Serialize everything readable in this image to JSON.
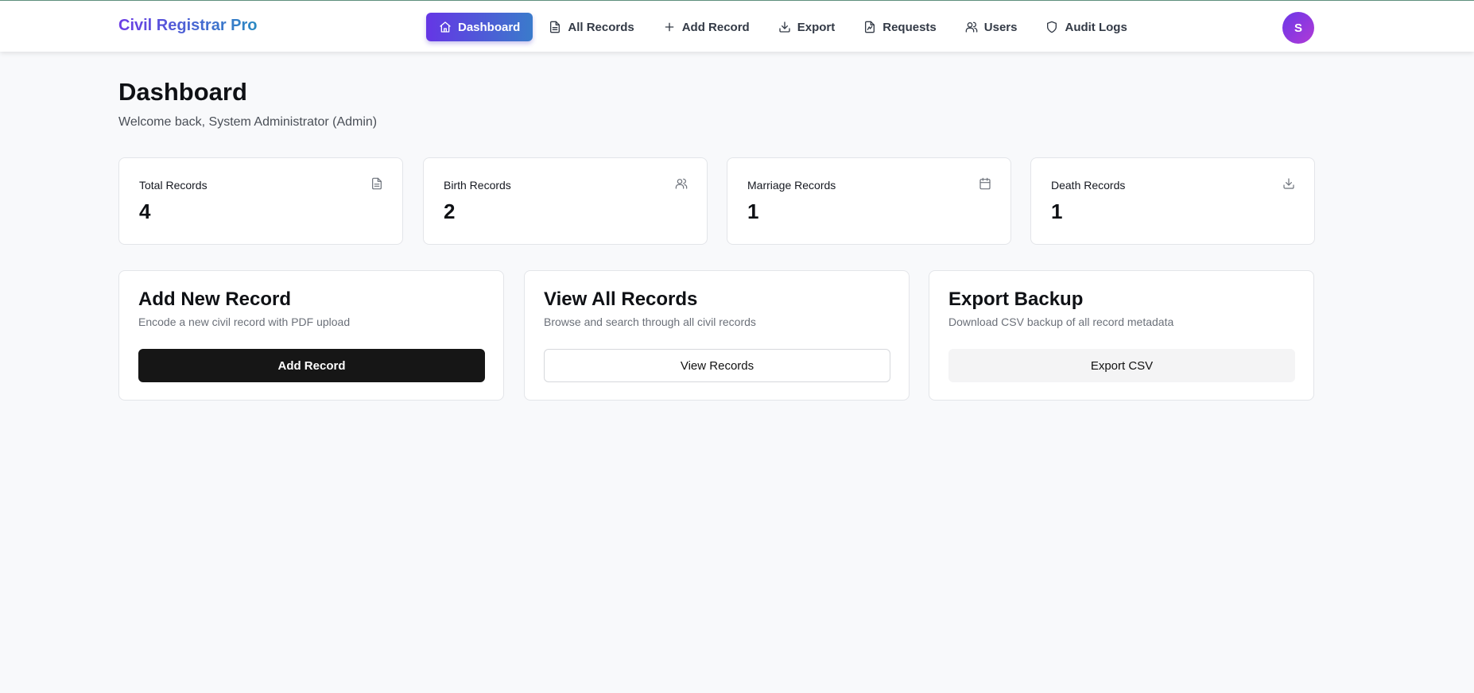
{
  "app": {
    "brand": "Civil Registrar Pro",
    "avatar_initial": "S"
  },
  "nav": [
    {
      "label": "Dashboard",
      "icon": "home-icon",
      "active": true
    },
    {
      "label": "All Records",
      "icon": "file-text-icon"
    },
    {
      "label": "Add Record",
      "icon": "plus-icon"
    },
    {
      "label": "Export",
      "icon": "download-icon"
    },
    {
      "label": "Requests",
      "icon": "file-signature-icon"
    },
    {
      "label": "Users",
      "icon": "users-icon"
    },
    {
      "label": "Audit Logs",
      "icon": "shield-icon"
    }
  ],
  "page": {
    "title": "Dashboard",
    "welcome": "Welcome back, System Administrator (Admin)"
  },
  "stats": [
    {
      "label": "Total Records",
      "value": "4",
      "icon": "file-text-icon"
    },
    {
      "label": "Birth Records",
      "value": "2",
      "icon": "users-icon"
    },
    {
      "label": "Marriage Records",
      "value": "1",
      "icon": "calendar-icon"
    },
    {
      "label": "Death Records",
      "value": "1",
      "icon": "download-icon"
    }
  ],
  "actions": [
    {
      "title": "Add New Record",
      "description": "Encode a new civil record with PDF upload",
      "button": "Add Record"
    },
    {
      "title": "View All Records",
      "description": "Browse and search through all civil records",
      "button": "View Records"
    },
    {
      "title": "Export Backup",
      "description": "Download CSV backup of all record metadata",
      "button": "Export CSV"
    }
  ],
  "colors": {
    "brand_gradient_start": "#6d3ce6",
    "brand_gradient_end": "#2a8ac2",
    "primary_button": "#161616",
    "background": "#f8f9fb"
  }
}
